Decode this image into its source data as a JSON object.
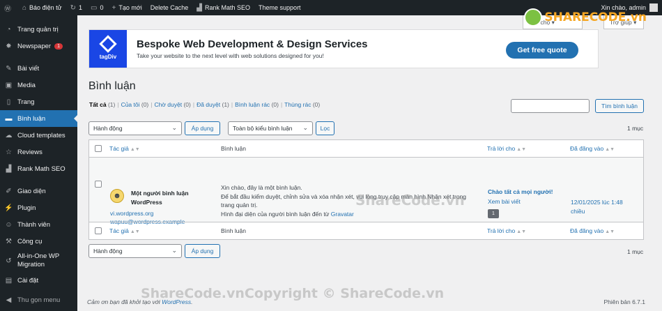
{
  "adminbar": {
    "site_name": "Báo điện tử",
    "updates_count": "1",
    "comments_count": "0",
    "new_label": "Tạo mới",
    "delete_cache": "Delete Cache",
    "rankmath": "Rank Math SEO",
    "theme_support": "Theme support",
    "greeting": "Xin chào, admin"
  },
  "screen_meta": {
    "options": "Tùy chọ",
    "help": "Trợ giúp"
  },
  "sidebar": {
    "items": [
      {
        "label": "Trang quản trị",
        "icon": "dashboard-icon"
      },
      {
        "label": "Newspaper",
        "icon": "newspaper-icon",
        "badge": "1"
      },
      {
        "label": "Bài viết",
        "icon": "pin-icon"
      },
      {
        "label": "Media",
        "icon": "media-icon"
      },
      {
        "label": "Trang",
        "icon": "page-icon"
      },
      {
        "label": "Bình luận",
        "icon": "comment-icon"
      },
      {
        "label": "Cloud templates",
        "icon": "cloud-icon"
      },
      {
        "label": "Reviews",
        "icon": "star-icon"
      },
      {
        "label": "Rank Math SEO",
        "icon": "chart-icon"
      },
      {
        "label": "Giao diện",
        "icon": "brush-icon"
      },
      {
        "label": "Plugin",
        "icon": "plugin-icon"
      },
      {
        "label": "Thành viên",
        "icon": "user-icon"
      },
      {
        "label": "Công cụ",
        "icon": "wrench-icon"
      },
      {
        "label": "All-in-One WP Migration",
        "icon": "migration-icon"
      },
      {
        "label": "Cài đặt",
        "icon": "settings-icon"
      },
      {
        "label": "Thu gọn menu",
        "icon": "collapse-icon"
      }
    ]
  },
  "banner": {
    "logo": "tagDiv",
    "title": "Bespoke Web Development & Design Services",
    "subtitle": "Take your website to the next level with web solutions designed for you!",
    "cta": "Get free quote"
  },
  "page": {
    "title": "Bình luận",
    "filters": {
      "all": "Tất cả",
      "all_count": "(1)",
      "mine": "Của tôi",
      "mine_count": "(0)",
      "pending": "Chờ duyệt",
      "pending_count": "(0)",
      "approved": "Đã duyệt",
      "approved_count": "(1)",
      "spam": "Bình luận rác",
      "spam_count": "(0)",
      "trash": "Thùng rác",
      "trash_count": "(0)"
    },
    "search_button": "Tìm bình luận",
    "bulk_action": "Hành động",
    "apply": "Áp dụng",
    "type_filter": "Toàn bộ kiểu bình luận",
    "filter_button": "Lọc",
    "item_count": "1 mục"
  },
  "table": {
    "headers": {
      "author": "Tác giả",
      "comment": "Bình luận",
      "reply_to": "Trả lời cho",
      "date": "Đã đăng vào"
    },
    "row": {
      "author_name": "Một người bình luận WordPress",
      "author_url": "vi.wordpress.org",
      "author_email": "wapuu@wordpress.example",
      "comment_p1": "Xin chào, đây là một bình luận.",
      "comment_p2": "Để bắt đầu kiểm duyệt, chỉnh sửa và xóa nhận xét, vui lòng truy cập màn hình Nhận xét trong trang quản trị.",
      "comment_p3_prefix": "Hình đại diện của người bình luận đến từ ",
      "comment_p3_link": "Gravatar",
      "reply_title": "Chào tất cả mọi người!",
      "view_post": "Xem bài viết",
      "bubble_count": "1",
      "date": "12/01/2025 lúc 1:48 chiều"
    }
  },
  "footer": {
    "thanks_prefix": "Cảm ơn bạn đã khởi tạo với ",
    "wordpress": "WordPress",
    "version": "Phiên bản 6.7.1"
  },
  "watermarks": {
    "logo_share": "SHARE",
    "logo_code": "CODE.vn",
    "center": "ShareCode.vn",
    "bottom": "ShareCode.vnCopyright © ShareCode.vn"
  }
}
